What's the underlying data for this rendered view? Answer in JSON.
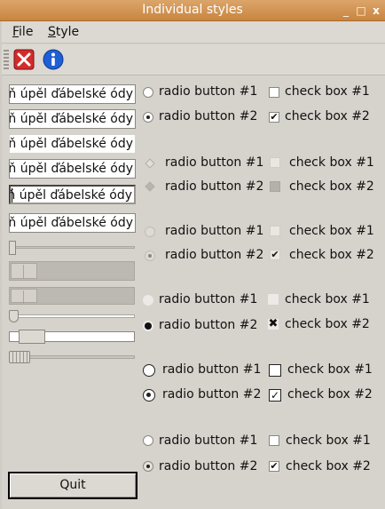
{
  "window": {
    "title": "Individual styles",
    "controls": [
      "_",
      "□",
      "x"
    ]
  },
  "menubar": {
    "items": [
      {
        "label": "File",
        "mnemonic": "F",
        "rest": "ile"
      },
      {
        "label": "Style",
        "mnemonic": "S",
        "rest": "tyle"
      }
    ]
  },
  "toolbar": {
    "buttons": [
      {
        "icon": "close-icon",
        "color": "#d42b2b"
      },
      {
        "icon": "info-icon",
        "color": "#1f5fd6"
      }
    ]
  },
  "line_edit_text": "iň úpěl ďábelské ódy",
  "line_edits": [
    {
      "value": "iň úpěl ďábelské ódy"
    },
    {
      "value": "iň úpěl ďábelské ódy"
    },
    {
      "value": "iň úpěl ďábelské ódy"
    },
    {
      "value": "iň úpěl ďábelské ódy"
    },
    {
      "value": "iň úpěl ďábelské ódy"
    },
    {
      "value": "iň úpěl ďábelské ódy"
    }
  ],
  "sliders": [
    {
      "value": 0.0
    },
    {
      "value": 0.0
    },
    {
      "value": 0.0
    },
    {
      "value": 0.0
    },
    {
      "value": 0.1
    },
    {
      "value": 0.0
    }
  ],
  "groups": [
    {
      "radio1": "radio button #1",
      "radio2": "radio button #2",
      "check1": "check box #1",
      "check2": "check box #2",
      "radio_selected": 2,
      "check2_checked": true,
      "check2_mark": "✔"
    },
    {
      "radio1": "radio button #1",
      "radio2": "radio button #2",
      "check1": "check box #1",
      "check2": "check box #2",
      "radio_selected": 2,
      "check2_checked": true,
      "check2_mark": ""
    },
    {
      "radio1": "radio button #1",
      "radio2": "radio button #2",
      "check1": "check box #1",
      "check2": "check box #2",
      "radio_selected": 2,
      "check2_checked": true,
      "check2_mark": "✔"
    },
    {
      "radio1": "radio button #1",
      "radio2": "radio button #2",
      "check1": "check box #1",
      "check2": "check box #2",
      "radio_selected": 2,
      "check2_checked": true,
      "check2_mark": "✖"
    },
    {
      "radio1": "radio button #1",
      "radio2": "radio button #2",
      "check1": "check box #1",
      "check2": "check box #2",
      "radio_selected": 2,
      "check2_checked": true,
      "check2_mark": "✓"
    },
    {
      "radio1": "radio button #1",
      "radio2": "radio button #2",
      "check1": "check box #1",
      "check2": "check box #2",
      "radio_selected": 2,
      "check2_checked": true,
      "check2_mark": "✔"
    }
  ],
  "quit_button": {
    "label": "Quit"
  }
}
